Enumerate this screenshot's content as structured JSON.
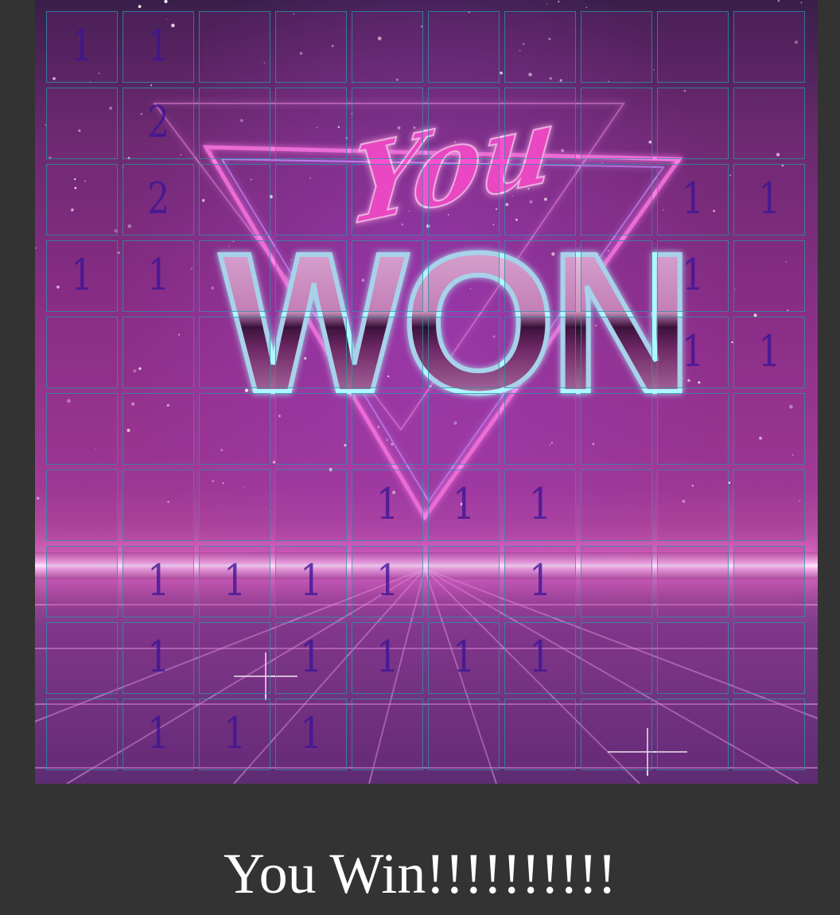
{
  "board": {
    "rows": [
      [
        "1",
        "1",
        "",
        "",
        "",
        "",
        "",
        "",
        "",
        ""
      ],
      [
        "",
        "2",
        "",
        "",
        "",
        "",
        "",
        "",
        "",
        ""
      ],
      [
        "",
        "2",
        "",
        "",
        "",
        "",
        "",
        "",
        "1",
        "1"
      ],
      [
        "1",
        "1",
        "",
        "",
        "",
        "",
        "",
        "",
        "1",
        ""
      ],
      [
        "",
        "",
        "",
        "",
        "",
        "",
        "",
        "",
        "1",
        "1"
      ],
      [
        "",
        "",
        "",
        "",
        "",
        "",
        "",
        "",
        "",
        ""
      ],
      [
        "",
        "",
        "",
        "",
        "1",
        "1",
        "1",
        "",
        "",
        ""
      ],
      [
        "",
        "1",
        "1",
        "1",
        "1",
        "",
        "1",
        "",
        "",
        ""
      ],
      [
        "",
        "1",
        "",
        "1",
        "1",
        "1",
        "1",
        "",
        "",
        ""
      ],
      [
        "",
        "1",
        "1",
        "1",
        "",
        "",
        "",
        "",
        "",
        ""
      ]
    ]
  },
  "banner": {
    "line1": "You",
    "line2": "WON"
  },
  "status": {
    "message": "You Win!!!!!!!!!!"
  },
  "colors": {
    "page_bg": "#333333",
    "number": "#3c1496",
    "cell_border": "#2896aa",
    "neon_pink": "#ff4fd0",
    "neon_cyan": "#7ff6ff"
  }
}
